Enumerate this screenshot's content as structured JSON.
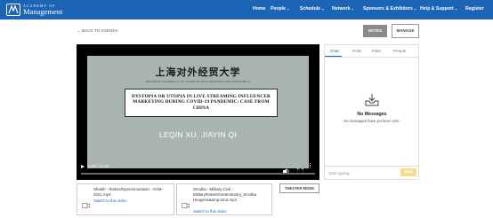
{
  "header": {
    "logo_top": "ACADEMY OF",
    "logo_bottom": "Management",
    "nav": [
      {
        "label": "Home",
        "dropdown": false
      },
      {
        "label": "People",
        "dropdown": true
      },
      {
        "label": "Schedule",
        "dropdown": true
      },
      {
        "label": "Network",
        "dropdown": true
      },
      {
        "label": "Sponsors & Exhibitors",
        "dropdown": true
      },
      {
        "label": "Help & Support",
        "dropdown": true
      },
      {
        "label": "Register",
        "dropdown": false
      }
    ],
    "chevron": "⌄"
  },
  "back_link": "← BACK TO AGENDA",
  "buttons": {
    "notes": "NOTES",
    "manage": "MANAGE",
    "theater": "THEATER MODE"
  },
  "video": {
    "slide_heading": "上海对外经贸大学",
    "slide_subheading": "SHANGHAI UNIVERSITY OF INTERNATIONAL BUSINESS AND ECONOMICS",
    "slide_title": "DYSTOPIA OR UTOPIA IN LIVE STREAMING INFLUENCER MARKETING DURING COVID-19 PANDEMIC: CASE FROM CHINA",
    "slide_authors": "LEQIN XU, JIAYIN QI",
    "time": "0:00 / 17:22",
    "progress": 0.0
  },
  "videos": [
    {
      "title": "Shaikh - RisksofOpenInnovation - AOM-2021.mp4",
      "link": "Switch to this video"
    },
    {
      "title": "Smolka - Military-Civil. - MilitaryRoleinDroneIndustry_Smolka Heugens&amp;arrot.mp4",
      "link": "Switch to this video"
    }
  ],
  "panel": {
    "tabs": [
      "Chat",
      "Polls",
      "Files",
      "People"
    ],
    "active_tab": "Chat",
    "empty_title": "No Messages",
    "empty_sub": "No messages have yet been sent.",
    "input_placeholder": "Start typing...",
    "send_label": "SEND"
  },
  "colors": {
    "brand": "#1c64b4",
    "send": "#f6dd8c",
    "notes_bg": "#8a8a8a"
  },
  "icons": [
    "logo-icon",
    "play-icon",
    "volume-icon",
    "fullscreen-icon",
    "more-icon",
    "video-file-icon",
    "inbox-icon"
  ]
}
